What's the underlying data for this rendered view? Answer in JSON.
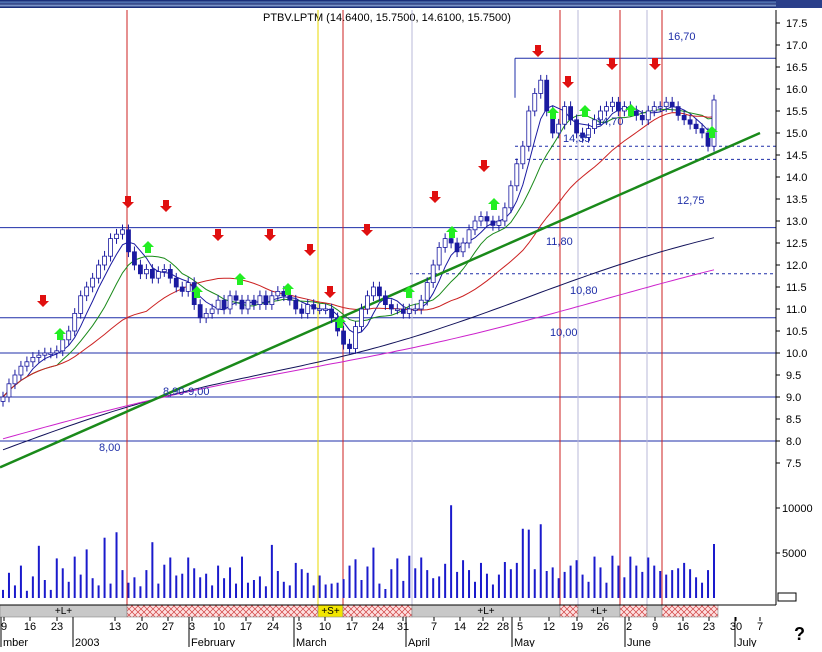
{
  "title": "PTBV.LPTM (14.6400, 15.7500, 14.6100, 15.7500)",
  "chart_data": {
    "type": "candlestick",
    "price_axis": {
      "ticks": [
        "17.5",
        "17.0",
        "16.5",
        "16.0",
        "15.5",
        "15.0",
        "14.5",
        "14.0",
        "13.5",
        "13.0",
        "12.5",
        "12.0",
        "11.5",
        "11.0",
        "10.5",
        "10.0",
        "9.5",
        "9.0",
        "8.5",
        "8.0",
        "7.5"
      ],
      "range": [
        7.2,
        17.9
      ]
    },
    "volume_axis": {
      "ticks": [
        "10000",
        "5000"
      ],
      "range": [
        0,
        12000
      ]
    },
    "x_axis": {
      "date_ticks": [
        "9",
        "16",
        "23",
        "13",
        "20",
        "27",
        "3",
        "10",
        "17",
        "24",
        "3",
        "10",
        "17",
        "24",
        "31",
        "7",
        "14",
        "22",
        "28",
        "5",
        "12",
        "19",
        "26",
        "2",
        "9",
        "16",
        "23",
        "30",
        "7"
      ],
      "month_labels": [
        "mber",
        "2003",
        "February",
        "March",
        "April",
        "May",
        "June",
        "July"
      ]
    },
    "levels": [
      {
        "label": "16,70",
        "value": 16.7
      },
      {
        "label": "14,70",
        "value": 14.7
      },
      {
        "label": "14,35",
        "value": 14.35
      },
      {
        "label": "12,75",
        "value": 12.8
      },
      {
        "label": "11,80",
        "value": 11.8
      },
      {
        "label": "10,80",
        "value": 10.8
      },
      {
        "label": "10,00",
        "value": 10.0
      },
      {
        "label": "8,90-9,00",
        "value": 8.9
      },
      {
        "label": "8,00",
        "value": 8.0
      }
    ],
    "signal_bands": [
      {
        "label": "+L+",
        "kind": "long"
      },
      {
        "label": "",
        "kind": "short"
      },
      {
        "label": "+S+",
        "kind": "flag"
      },
      {
        "label": "",
        "kind": "short"
      },
      {
        "label": "+L+",
        "kind": "long"
      },
      {
        "label": "",
        "kind": "short"
      },
      {
        "label": "+L+",
        "kind": "long"
      },
      {
        "label": "",
        "kind": "short"
      },
      {
        "label": "",
        "kind": "long"
      },
      {
        "label": "",
        "kind": "short"
      }
    ],
    "close_series": [
      9.0,
      9.3,
      9.5,
      9.7,
      9.8,
      9.9,
      9.95,
      10.0,
      10.0,
      10.05,
      10.3,
      10.5,
      10.9,
      11.3,
      11.5,
      11.7,
      12.0,
      12.2,
      12.6,
      12.7,
      12.8,
      12.3,
      12.0,
      11.8,
      11.9,
      11.7,
      11.85,
      11.9,
      11.7,
      11.5,
      11.4,
      11.6,
      11.1,
      10.8,
      10.9,
      11.0,
      11.2,
      11.0,
      11.3,
      11.2,
      11.0,
      11.2,
      11.1,
      11.3,
      11.1,
      11.3,
      11.4,
      11.3,
      11.2,
      11.0,
      10.9,
      11.1,
      11.0,
      11.0,
      11.0,
      10.8,
      10.5,
      10.2,
      10.1,
      10.6,
      11.0,
      11.3,
      11.5,
      11.3,
      11.1,
      11.0,
      11.0,
      10.9,
      11.0,
      11.0,
      11.2,
      11.6,
      12.0,
      12.4,
      12.6,
      12.5,
      12.3,
      12.5,
      12.8,
      13.0,
      13.1,
      13.0,
      12.9,
      13.0,
      13.3,
      13.8,
      14.3,
      14.7,
      15.5,
      15.9,
      16.2,
      15.5,
      15.0,
      15.2,
      15.6,
      15.3,
      15.0,
      14.9,
      15.1,
      15.3,
      15.5,
      15.6,
      15.7,
      15.5,
      15.6,
      15.5,
      15.4,
      15.3,
      15.5,
      15.6,
      15.6,
      15.7,
      15.6,
      15.4,
      15.3,
      15.2,
      15.1,
      15.0,
      14.7,
      15.75
    ],
    "volume_series": [
      900,
      2800,
      1400,
      3600,
      800,
      2400,
      5800,
      2000,
      900,
      4400,
      3300,
      1800,
      4600,
      2600,
      5400,
      2200,
      1400,
      6700,
      1600,
      7300,
      3100,
      1700,
      2300,
      1300,
      3100,
      6200,
      1600,
      3700,
      4500,
      2500,
      2700,
      4500,
      3300,
      2300,
      2700,
      1400,
      3600,
      2200,
      3400,
      1600,
      4600,
      1700,
      2000,
      2400,
      1300,
      5900,
      3000,
      1800,
      1400,
      3900,
      3200,
      2800,
      1400,
      2500,
      1500,
      1600,
      1700,
      2100,
      3600,
      4300,
      2000,
      3500,
      5600,
      1600,
      1000,
      3200,
      4400,
      1900,
      4700,
      3300,
      4500,
      3100,
      2200,
      2400,
      3800,
      10300,
      2900,
      4200,
      3100,
      1800,
      3900,
      2700,
      1500,
      2600,
      4000,
      3200,
      3900,
      7700,
      7600,
      3200,
      8200,
      3000,
      3400,
      2200,
      2900,
      3600,
      4200,
      2600,
      1800,
      4600,
      3400,
      1700,
      4700,
      3600,
      2300,
      4600,
      3600,
      2900,
      4500,
      3600,
      3000,
      2600,
      3100,
      3300,
      3900,
      3200,
      2300,
      1700,
      3100,
      6000
    ]
  }
}
